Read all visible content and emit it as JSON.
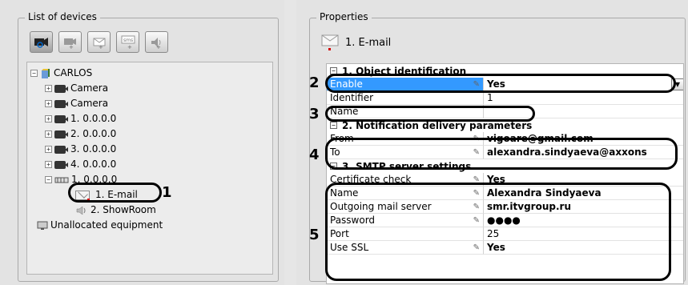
{
  "devices": {
    "legend": "List of devices",
    "toolbar": [
      "camera-search-icon",
      "add-camera-icon",
      "add-email-icon",
      "add-sms-icon",
      "add-sound-icon"
    ],
    "toolbar_sub": [
      "",
      "+",
      "+",
      "sms",
      "+"
    ],
    "tree": {
      "root": "CARLOS",
      "items": [
        "Camera",
        "Camera",
        "1. 0.0.0.0",
        "2. 0.0.0.0",
        "3. 0.0.0.0",
        "4. 0.0.0.0",
        "1. 0.0.0.0"
      ],
      "email": "1. E-mail",
      "showroom": "2. ShowRoom",
      "unallocated": "Unallocated equipment"
    }
  },
  "properties": {
    "legend": "Properties",
    "header": "1. E-mail",
    "sections": {
      "s1": "1. Object identification",
      "s2": "2. Notification delivery parameters",
      "s3": "3. SMTP server settings"
    },
    "rows": {
      "enable_label": "Enable",
      "enable_value": "Yes",
      "identifier_label": "Identifier",
      "identifier_value": "1",
      "name_label": "Name",
      "name_value": "",
      "from_label": "From",
      "from_value": "vigoare@gmail.com",
      "to_label": "To",
      "to_value": "alexandra.sindyaeva@axxons",
      "cert_label": "Certificate check",
      "cert_value": "Yes",
      "smtp_name_label": "Name",
      "smtp_name_value": "Alexandra Sindyaeva",
      "server_label": "Outgoing mail server",
      "server_value": "smr.itvgroup.ru",
      "password_label": "Password",
      "password_value": "●●●●",
      "port_label": "Port",
      "port_value": "25",
      "ssl_label": "Use SSL",
      "ssl_value": "Yes"
    }
  },
  "callouts": [
    "1",
    "2",
    "3",
    "4",
    "5"
  ],
  "colors": {
    "selection": "#3399ff",
    "accent_red": "#d40000"
  }
}
